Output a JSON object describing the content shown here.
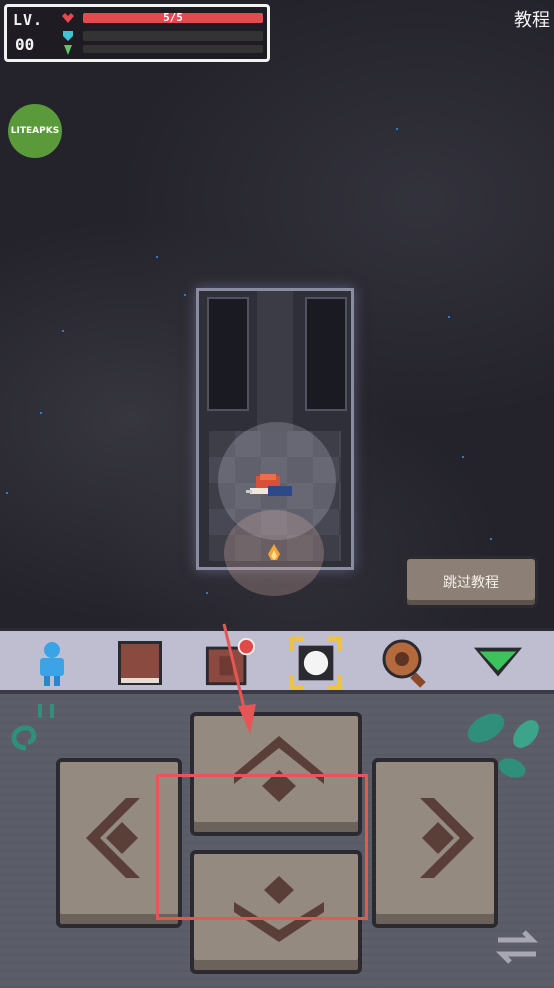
{
  "hud": {
    "level_label": "LV.",
    "level_value": "00",
    "hp_text": "5/5",
    "hp_fraction": 1.0,
    "shield_fraction": 0.0,
    "energy_fraction": 0.0,
    "hp_color": "#e5484d",
    "shield_color": "#3fc4d6",
    "energy_color": "#61c36a"
  },
  "header": {
    "title": "教程"
  },
  "watermark": {
    "text": "LITEAPKS"
  },
  "skip_button": {
    "label": "跳过教程"
  },
  "toolbar": {
    "items": [
      {
        "icon": "character-icon"
      },
      {
        "icon": "book-icon"
      },
      {
        "icon": "backpack-icon",
        "notification": true
      },
      {
        "icon": "center-target-icon",
        "selected": true
      },
      {
        "icon": "magnifier-icon"
      },
      {
        "icon": "collapse-arrow-icon"
      }
    ]
  },
  "controls": {
    "buttons": [
      "move-left",
      "move-up",
      "move-right",
      "move-down"
    ],
    "highlight_color": "#e85555"
  }
}
